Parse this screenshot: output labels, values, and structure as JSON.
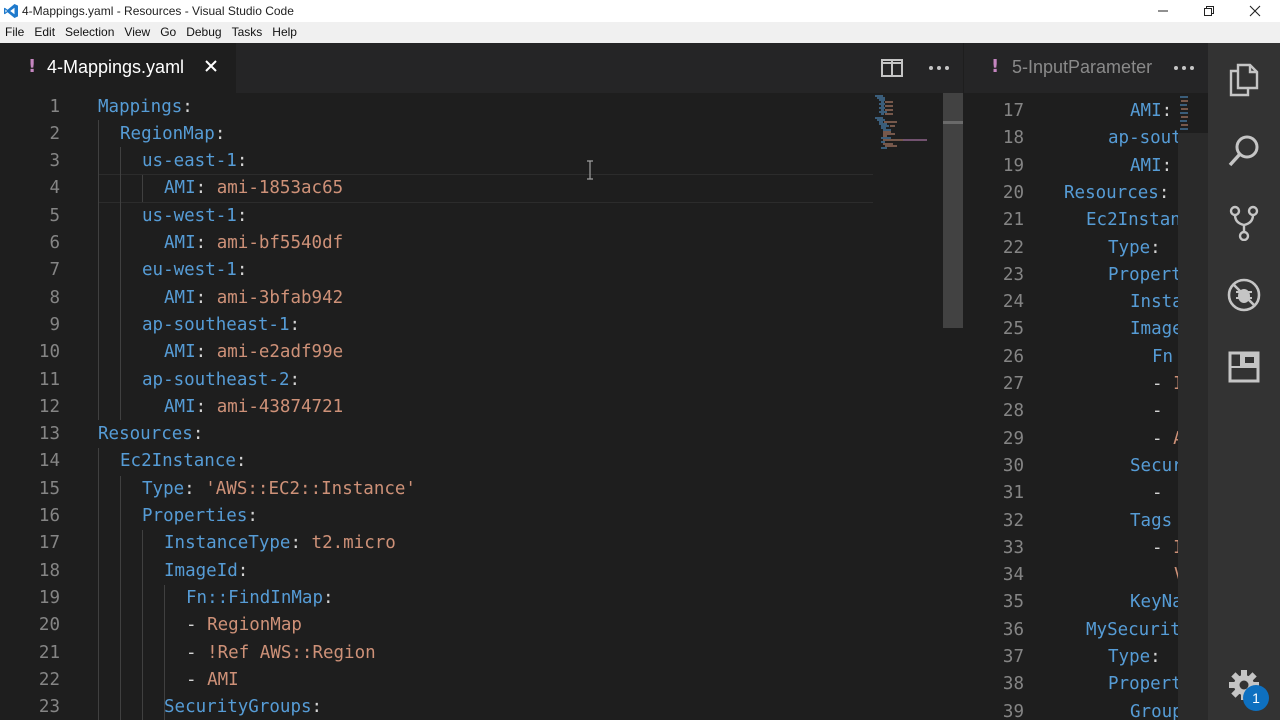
{
  "window": {
    "title": "4-Mappings.yaml - Resources - Visual Studio Code"
  },
  "menu": [
    "File",
    "Edit",
    "Selection",
    "View",
    "Go",
    "Debug",
    "Tasks",
    "Help"
  ],
  "left_editor": {
    "tab_marker": "!",
    "tab_label": "4-Mappings.yaml",
    "lines": [
      {
        "n": "1",
        "key": "Mappings",
        "val": ""
      },
      {
        "n": "2",
        "key": "RegionMap",
        "val": ""
      },
      {
        "n": "3",
        "key": "us-east-1",
        "val": ""
      },
      {
        "n": "4",
        "key": "AMI",
        "val": "ami-1853ac65"
      },
      {
        "n": "5",
        "key": "us-west-1",
        "val": ""
      },
      {
        "n": "6",
        "key": "AMI",
        "val": "ami-bf5540df"
      },
      {
        "n": "7",
        "key": "eu-west-1",
        "val": ""
      },
      {
        "n": "8",
        "key": "AMI",
        "val": "ami-3bfab942"
      },
      {
        "n": "9",
        "key": "ap-southeast-1",
        "val": ""
      },
      {
        "n": "10",
        "key": "AMI",
        "val": "ami-e2adf99e"
      },
      {
        "n": "11",
        "key": "ap-southeast-2",
        "val": ""
      },
      {
        "n": "12",
        "key": "AMI",
        "val": "ami-43874721"
      },
      {
        "n": "13",
        "key": "Resources",
        "val": ""
      },
      {
        "n": "14",
        "key": "Ec2Instance",
        "val": ""
      },
      {
        "n": "15",
        "key": "Type",
        "val": "'AWS::EC2::Instance'"
      },
      {
        "n": "16",
        "key": "Properties",
        "val": ""
      },
      {
        "n": "17",
        "key": "InstanceType",
        "val": "t2.micro"
      },
      {
        "n": "18",
        "key": "ImageId",
        "val": ""
      },
      {
        "n": "19",
        "key": "Fn::FindInMap",
        "val": ""
      },
      {
        "n": "20",
        "dash": "- ",
        "val": "RegionMap"
      },
      {
        "n": "21",
        "dash": "- ",
        "val": "!Ref AWS::Region"
      },
      {
        "n": "22",
        "dash": "- ",
        "val": "AMI"
      },
      {
        "n": "23",
        "key": "SecurityGroups",
        "val": ""
      }
    ]
  },
  "right_editor": {
    "tab_marker": "!",
    "tab_label": "5-InputParameter",
    "lines": [
      {
        "n": "17",
        "text": "AMI:"
      },
      {
        "n": "18",
        "text": "ap-sout"
      },
      {
        "n": "19",
        "text": "AMI:"
      },
      {
        "n": "20",
        "text": "Resources:"
      },
      {
        "n": "21",
        "text": "Ec2Instan"
      },
      {
        "n": "22",
        "text": "Type:"
      },
      {
        "n": "23",
        "text": "Propert"
      },
      {
        "n": "24",
        "text": "Insta"
      },
      {
        "n": "25",
        "text": "Image"
      },
      {
        "n": "26",
        "text": "Fn"
      },
      {
        "n": "27",
        "text": "- I"
      },
      {
        "n": "28",
        "text": "-"
      },
      {
        "n": "29",
        "text": "- A"
      },
      {
        "n": "30",
        "text": "Secur"
      },
      {
        "n": "31",
        "text": "-"
      },
      {
        "n": "32",
        "text": "Tags"
      },
      {
        "n": "33",
        "text": "- I"
      },
      {
        "n": "34",
        "text": "V"
      },
      {
        "n": "35",
        "text": "KeyNa"
      },
      {
        "n": "36",
        "text": "MySecurit"
      },
      {
        "n": "37",
        "text": "Type:"
      },
      {
        "n": "38",
        "text": "Propert"
      },
      {
        "n": "39",
        "text": "Group"
      }
    ]
  },
  "activity_bar": {
    "icons": [
      "explorer-icon",
      "search-icon",
      "source-control-icon",
      "debug-icon",
      "extensions-icon",
      "settings-gear-icon"
    ],
    "settings_badge": "1"
  },
  "colors": {
    "key": "#569cd6",
    "string": "#ce9178",
    "line_number": "#858585",
    "editor_bg": "#1e1e1e",
    "badge": "#0e70c0"
  }
}
